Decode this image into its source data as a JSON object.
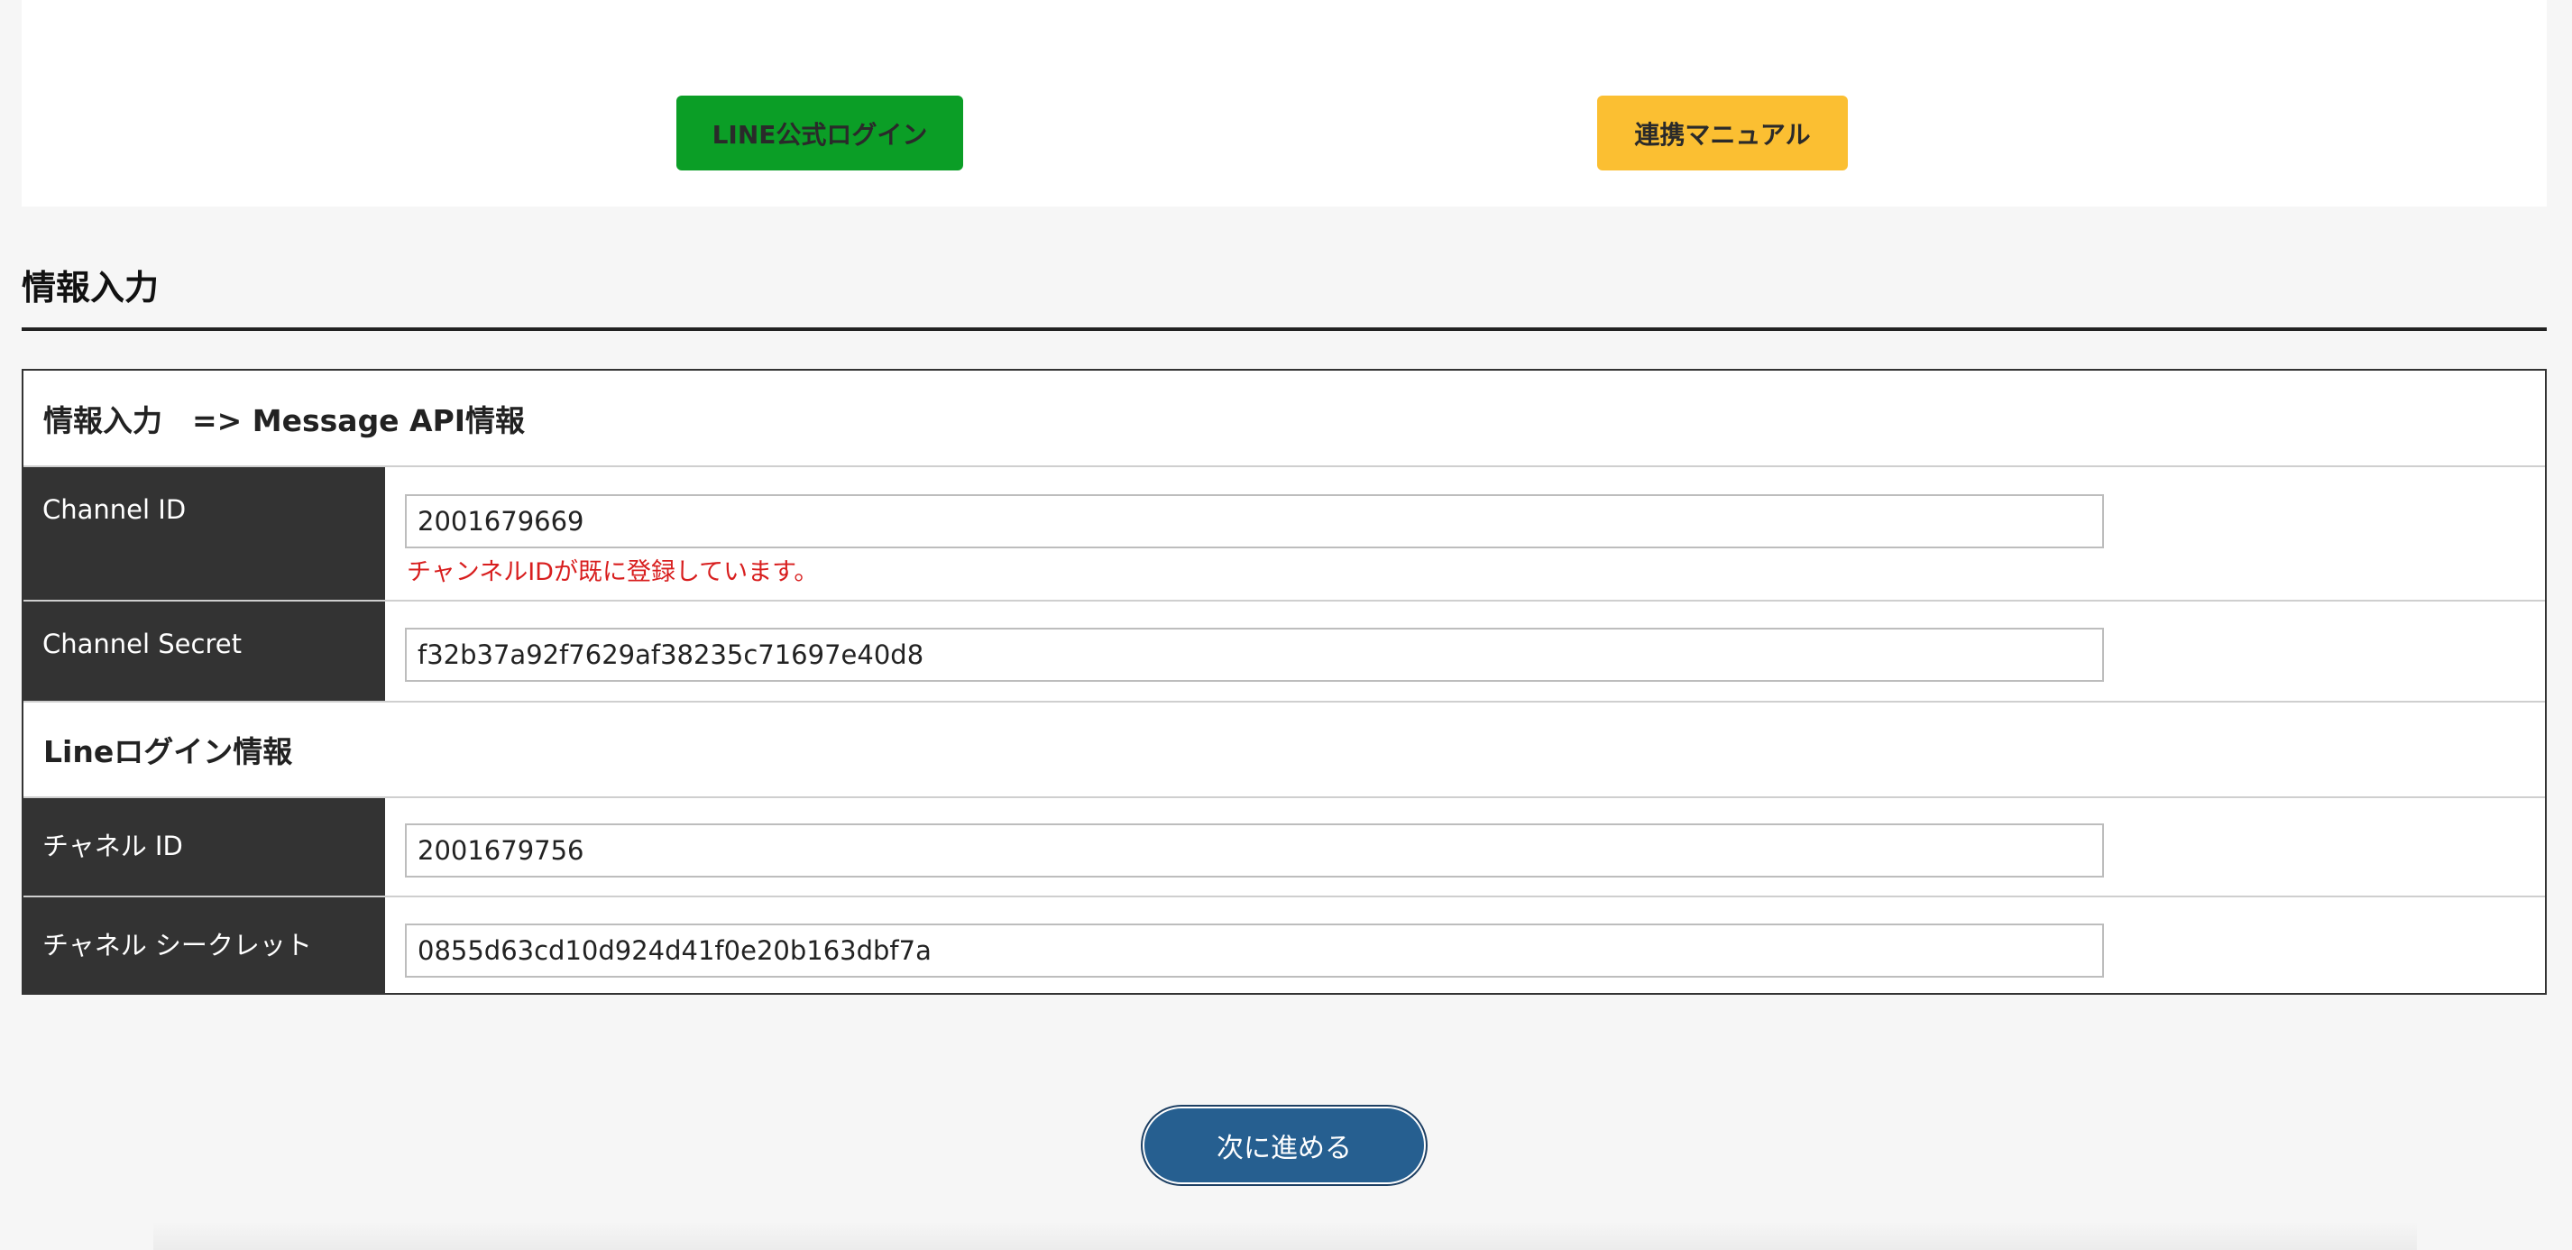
{
  "top_buttons": {
    "line_login": {
      "label": "LINE公式ログイン",
      "color": "#0b9e26"
    },
    "manual": {
      "label": "連携マニュアル",
      "color": "#fbbf32"
    }
  },
  "section": {
    "title": "情報入力"
  },
  "form": {
    "group1_title": "情報入力　=> Message API情報",
    "channel_id": {
      "label": "Channel ID",
      "value": "2001679669",
      "error": "チャンネルIDが既に登録しています。"
    },
    "channel_secret": {
      "label": "Channel Secret",
      "value": "f32b37a92f7629af38235c71697e40d8"
    },
    "group2_title": "Lineログイン情報",
    "login_channel_id": {
      "label": "チャネル ID",
      "value": "2001679756"
    },
    "login_channel_secret": {
      "label": "チャネル シークレット",
      "value": "0855d63cd10d924d41f0e20b163dbf7a"
    }
  },
  "next_button": {
    "label": "次に進める",
    "color": "#265f90"
  },
  "colors": {
    "label_bg": "#333333",
    "error": "#d81e1e",
    "page_bg": "#f6f6f6"
  }
}
